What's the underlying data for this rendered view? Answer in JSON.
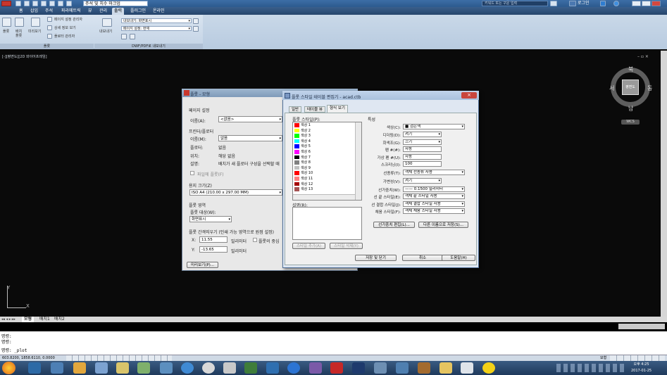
{
  "titlebar": {
    "workspace": "주석 및 치수 마크업",
    "search_placeholder": "키워드 또는 구문 입력",
    "login": "로그인"
  },
  "ribbon_tabs": [
    "홈",
    "삽입",
    "주석",
    "파라메트릭",
    "뷰",
    "관리",
    "출력",
    "플러그인",
    "온라인"
  ],
  "ribbon_active_tab": "출력",
  "ribbon": {
    "plot_group": {
      "buttons": [
        "플롯",
        "배치 플롯"
      ],
      "preview": "미리보기",
      "links": [
        "페이지 설정 관리자",
        "상세 정보 보기",
        "플로터 관리자"
      ],
      "title": "플롯"
    },
    "export_group": {
      "export_button": "내보내기",
      "export_value": "내보내기: 화면표시",
      "page_setup_value": "페이지 설정: 현재",
      "title": "DWF/PDF로 내보내기"
    }
  },
  "viewport_label": "[-][평면도][2D 와이어프레임]",
  "viewcube": {
    "north": "북",
    "south": "남",
    "west": "서",
    "east": "동",
    "face": "평면도",
    "wcs": "WCS"
  },
  "ucs": {
    "x": "X",
    "y": "Y"
  },
  "layout_tabs": [
    "모형",
    "배치1",
    "배치2"
  ],
  "command_lines": [
    "명령:",
    "명령:",
    "명령: _plot"
  ],
  "coordinates": "603.8200, 1858.6110, 0.0000",
  "model_label": "모형",
  "clock": {
    "time": "오후 4:25",
    "date": "2017-01-25"
  },
  "plot_dialog": {
    "title": "플롯 - 모형",
    "page_setup": "페이지 설정",
    "name_label": "이름(A):",
    "name_value": "<없음>",
    "printer_section": "프린터/플로터",
    "printer_name_label": "이름(M):",
    "printer_name_value": "없음",
    "plotter_label": "플로터:",
    "plotter_value": "없음",
    "where_label": "위치:",
    "where_value": "해당 없음",
    "desc_label": "설명:",
    "desc_value": "배치가 새 플로터 구성을 선택할 때",
    "plot_to_file": "파일에 플롯(F)",
    "paper_size_label": "용지 크기(Z)",
    "paper_size_value": "ISO A4 (210.00 x 297.00 MM)",
    "plot_area": "플롯 영역",
    "what_to_plot": "플롯 대상(W):",
    "what_to_plot_value": "화면표시",
    "offset_label": "플롯 간격띄우기 (인쇄 가능 영역으로 원점 설정)",
    "x_label": "X:",
    "x_value": "11.55",
    "y_label": "Y:",
    "y_value": "-13.65",
    "unit": "밀리미터",
    "center_plot": "플롯의 중심",
    "preview_button": "미리보기(P)..."
  },
  "style_editor": {
    "title": "플롯 스타일 테이블 편집기 - acad.ctb",
    "tabs": [
      "일반",
      "테이블 뷰",
      "형식 보기"
    ],
    "active_tab": "형식 보기",
    "plot_styles_label": "플롯 스타일(P):",
    "styles": [
      {
        "name": "색상 1",
        "color": "#ff0000"
      },
      {
        "name": "색상 2",
        "color": "#ffff00"
      },
      {
        "name": "색상 3",
        "color": "#00ff00"
      },
      {
        "name": "색상 4",
        "color": "#00ffff"
      },
      {
        "name": "색상 5",
        "color": "#0000ff"
      },
      {
        "name": "색상 6",
        "color": "#ff00ff"
      },
      {
        "name": "색상 7",
        "color": "#000000"
      },
      {
        "name": "색상 8",
        "color": "#808080"
      },
      {
        "name": "색상 9",
        "color": "#c0c0c0"
      },
      {
        "name": "색상 10",
        "color": "#ff0000"
      },
      {
        "name": "색상 11",
        "color": "#ff7f7f"
      },
      {
        "name": "색상 12",
        "color": "#a50000"
      },
      {
        "name": "색상 13",
        "color": "#a55252"
      }
    ],
    "description_label": "설명(R):",
    "add_style": "스타일 추가(A)",
    "delete_style": "스타일 삭제(Y)",
    "properties_label": "특성",
    "properties": [
      {
        "label": "색상(C):",
        "value": "■ 검은색"
      },
      {
        "label": "디더링(D):",
        "value": "켜기"
      },
      {
        "label": "회색조(G):",
        "value": "끄기"
      },
      {
        "label": "펜 #(#):",
        "value": "자동"
      },
      {
        "label": "가상 펜 #(U):",
        "value": "자동"
      },
      {
        "label": "스크리닝(I):",
        "value": "100"
      },
      {
        "label": "선종류(T):",
        "value": "객체 선종류 사용"
      },
      {
        "label": "가변성(V):",
        "value": "켜기"
      },
      {
        "label": "선가중치(W):",
        "value": "—— 0.1500 밀리미터"
      },
      {
        "label": "선 끝 스타일(E):",
        "value": "객체 끝 스타일 사용"
      },
      {
        "label": "선 결합 스타일(J):",
        "value": "객체 결합 스타일 사용"
      },
      {
        "label": "채움 스타일(F):",
        "value": "객체 채움 스타일 사용"
      }
    ],
    "edit_lineweights": "선가중치 편집(L)...",
    "save_as": "다른 이름으로 저장(S)...",
    "save_close": "저장 및 닫기",
    "cancel": "취소",
    "help": "도움말(H)"
  }
}
